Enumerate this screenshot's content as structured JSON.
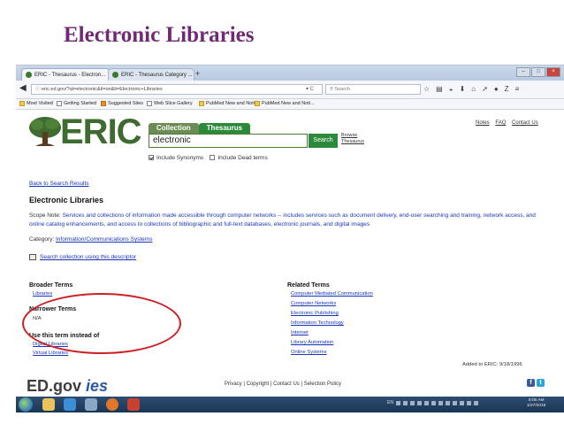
{
  "slide": {
    "title": "Electronic Libraries"
  },
  "browser": {
    "tabs": [
      {
        "label": "ERIC - Thesaurus - Electron..."
      },
      {
        "label": "ERIC - Thesaurus Category ..."
      }
    ],
    "new_tab_label": "+",
    "url": "eric.ed.gov/?qt=electronic&ti=on&ti=Electronic+Libraries",
    "search_placeholder": "Search",
    "bookmarks": [
      "Most Visited",
      "Getting Started",
      "Suggested Sites",
      "Web Slice Gallery",
      "PubMed New and Noti...",
      "PubMed New and Noti..."
    ]
  },
  "page": {
    "logo_text": "ERIC",
    "top_links": [
      "Notes",
      "FAQ",
      "Contact Us"
    ],
    "search_tabs": [
      "Collection",
      "Thesaurus"
    ],
    "search_value": "electronic",
    "search_button": "Search",
    "browse_link_1": "Browse",
    "browse_link_2": "Thesaurus",
    "include_synonyms": "Include Synonyms",
    "include_dead_terms": "Include Dead terms",
    "back_link": "Back to Search Results",
    "term_title": "Electronic Libraries",
    "scope_label": "Scope Note:",
    "scope_text": "Services and collections of information made accessible through computer networks -- includes services such as document delivery, end-user searching and training, network access, and online catalog enhancements, and access to collections of bibliographic and full-text databases, electronic journals, and digital images",
    "category_label": "Category:",
    "category_value": "Information/Communications Systems",
    "search_descriptor_link": "Search collection using this descriptor",
    "broader_heading": "Broader Terms",
    "broader_terms": [
      "Libraries"
    ],
    "narrower_heading": "Narrower Terms",
    "narrower_value": "N/A",
    "use_instead_heading": "Use this term instead of",
    "use_instead_terms": [
      "Digital Libraries",
      "Virtual Libraries"
    ],
    "related_heading": "Related Terms",
    "related_terms": [
      "Computer Mediated Communication",
      "Computer Networks",
      "Electronic Publishing",
      "Information Technology",
      "Internet",
      "Library Automation",
      "Online Systems"
    ],
    "added_text": "Added to ERIC: 9/18/1996",
    "footer_logo_a": "ED.gov",
    "footer_logo_b": "ies",
    "footer_links": "Privacy | Copyright | Contact Us | Selection Policy"
  },
  "taskbar": {
    "tray_label": "EN",
    "clock_time": "8:05 AM",
    "clock_date": "1/27/2016"
  },
  "colors": {
    "slide_title": "#6f2a73",
    "eric_green": "#3f6b30",
    "link_blue": "#1a35b8",
    "annotation_red": "#cc1f25",
    "taskbar": "#1b3554"
  }
}
